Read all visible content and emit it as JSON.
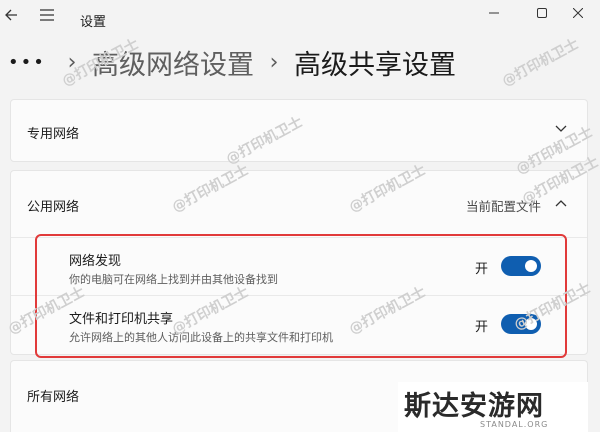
{
  "window": {
    "title": "设置"
  },
  "breadcrumb": {
    "dots": "•••",
    "sep": "›",
    "parent": "高级网络设置",
    "current": "高级共享设置"
  },
  "sections": {
    "private": {
      "label": "专用网络"
    },
    "public": {
      "label": "公用网络",
      "tag": "当前配置文件",
      "settings": [
        {
          "title": "网络发现",
          "desc": "你的电脑可在网络上找到并由其他设备找到",
          "state": "开",
          "on": true
        },
        {
          "title": "文件和打印机共享",
          "desc": "允许网络上的其他人访问此设备上的共享文件和打印机",
          "state": "开",
          "on": true
        }
      ]
    },
    "all": {
      "label": "所有网络"
    }
  },
  "watermark": {
    "text": "@打印机卫士"
  },
  "logo": {
    "main": "斯达安游网",
    "sub": "STANDAL.ORG"
  },
  "colors": {
    "accent": "#0f5eb0",
    "highlight": "#e13a3a"
  },
  "icons": [
    "back-arrow-icon",
    "hamburger-menu-icon",
    "minimize-icon",
    "maximize-icon",
    "close-icon",
    "chevron-down-icon",
    "chevron-up-icon"
  ]
}
